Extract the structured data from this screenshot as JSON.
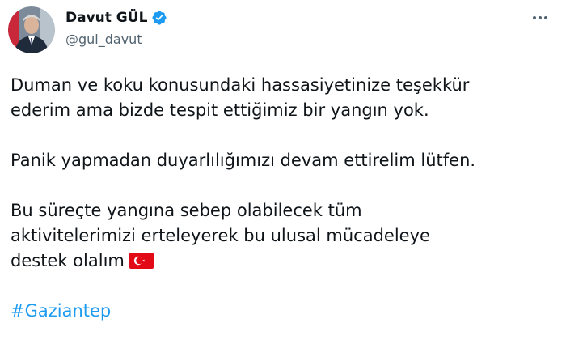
{
  "author": {
    "display_name": "Davut GÜL",
    "handle": "@gul_davut",
    "verified": true,
    "verified_icon": "verified-badge-icon",
    "verified_color": "#1d9bf0"
  },
  "more_icon": "more-options-icon",
  "tweet": {
    "p1_line1": "Duman ve koku konusundaki hassasiyetinize teşekkür",
    "p1_line2": "ederim ama bizde tespit ettiğimiz bir yangın yok.",
    "p2_line1": "Panik yapmadan duyarlılığımızı devam ettirelim lütfen.",
    "p3_line1": "Bu süreçte yangına sebep olabilecek tüm",
    "p3_line2": "aktivitelerimizi erteleyerek bu ulusal mücadeleye",
    "p3_line3": "destek olalım",
    "flag_icon": "turkey-flag-icon",
    "hashtag": "#Gaziantep"
  },
  "colors": {
    "text": "#0f1419",
    "secondary": "#536471",
    "link": "#1d9bf0",
    "flag_red": "#e30a17"
  }
}
